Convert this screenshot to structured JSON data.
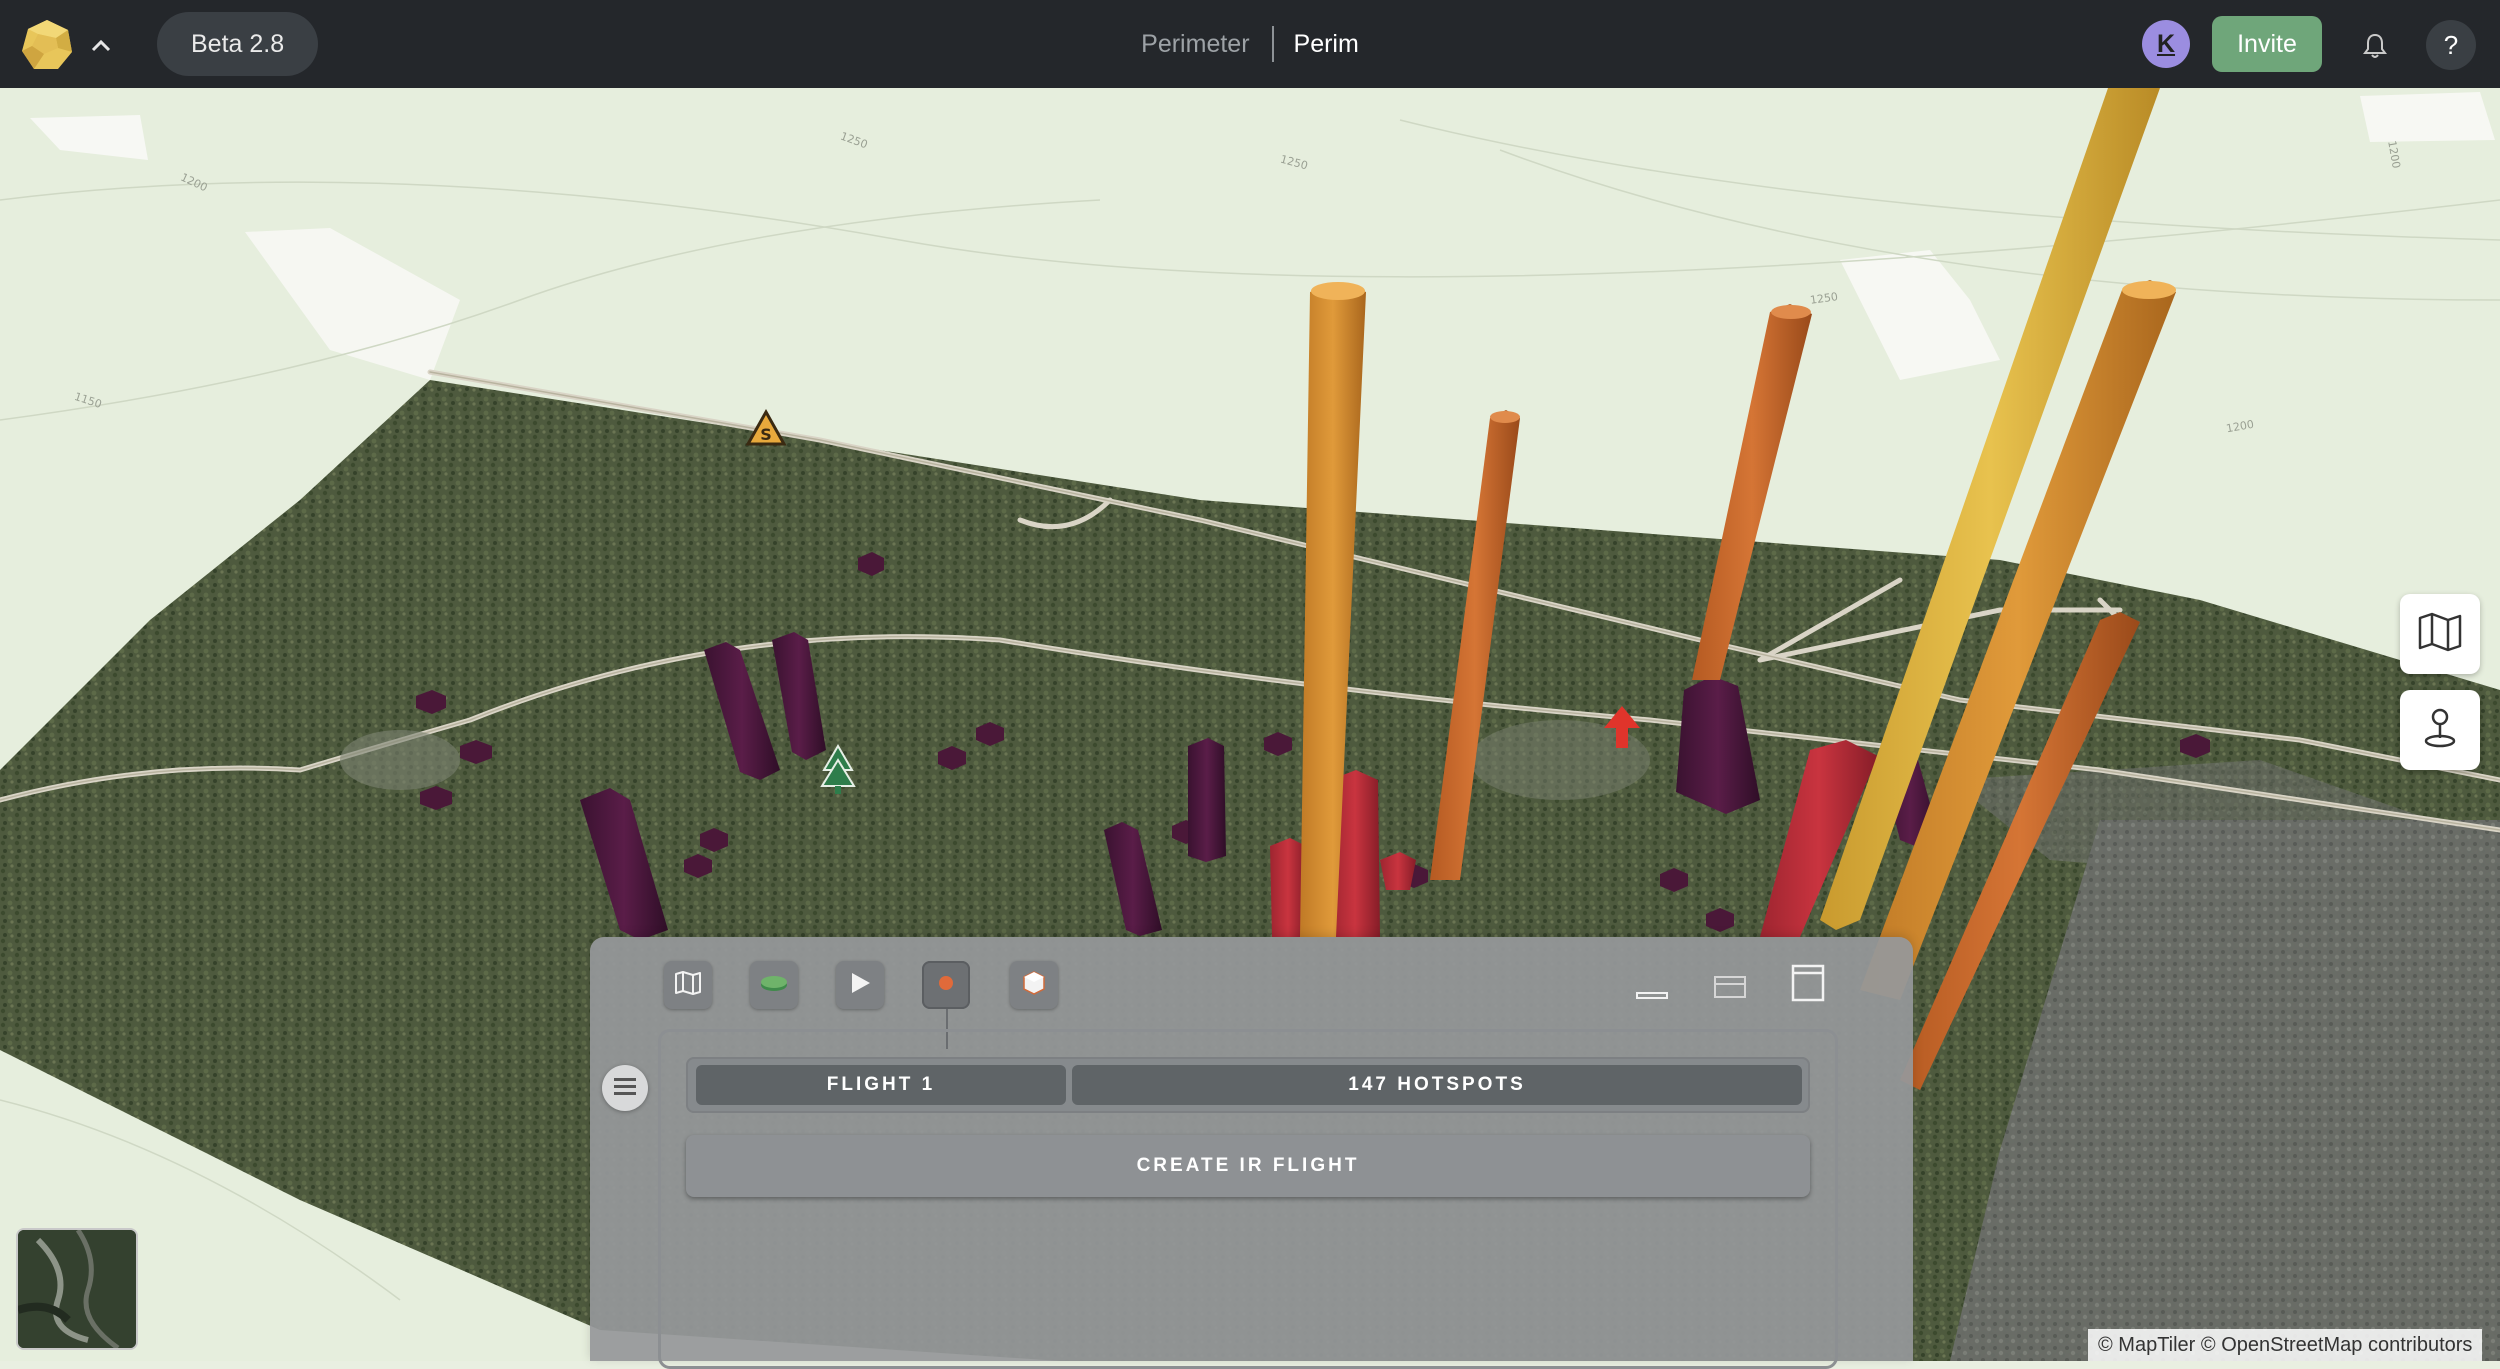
{
  "topbar": {
    "version_label": "Beta 2.8",
    "breadcrumb_parent": "Perimeter",
    "breadcrumb_current": "Perim",
    "avatar_initial": "K",
    "invite_label": "Invite",
    "help_label": "?"
  },
  "map": {
    "contour_labels": [
      "1250",
      "1200",
      "1250",
      "1250",
      "1150",
      "1200",
      "1200"
    ],
    "attribution": "© MapTiler © OpenStreetMap contributors",
    "side_controls": [
      "map-view-icon",
      "location-pin-icon"
    ],
    "markers": [
      "safety-zone-icon",
      "tree-icon",
      "wind-arrow-icon"
    ]
  },
  "panel": {
    "tools": [
      "map-icon",
      "layers-icon",
      "play-icon",
      "hotspot-icon",
      "model-icon"
    ],
    "size_controls": [
      "minimize-icon",
      "half-size-icon",
      "full-size-icon"
    ],
    "flight_label": "FLIGHT 1",
    "hotspots_label": "147 HOTSPOTS",
    "create_label": "CREATE IR FLIGHT"
  },
  "colors": {
    "topbar_bg": "#24272b",
    "invite_bg": "#6fa67a",
    "avatar_bg": "#9b8de0",
    "panel_bg": "#96989a",
    "hotspot_low": "#4a1838",
    "hotspot_mid": "#c0303c",
    "hotspot_high": "#e08a2e",
    "hotspot_max": "#e9c14a"
  }
}
